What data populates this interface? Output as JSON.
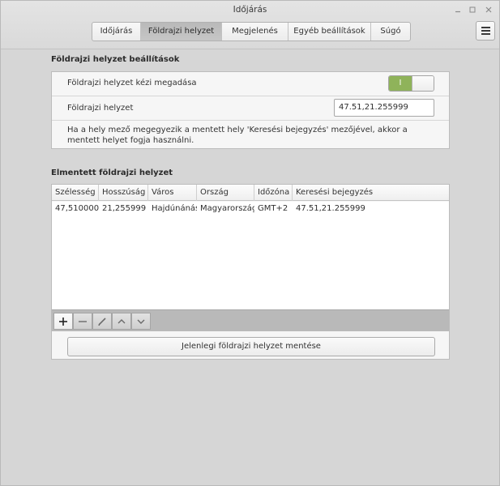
{
  "window": {
    "title": "Időjárás"
  },
  "tabs": [
    {
      "label": "Időjárás"
    },
    {
      "label": "Földrajzi helyzet"
    },
    {
      "label": "Megjelenés"
    },
    {
      "label": "Egyéb beállítások"
    },
    {
      "label": "Súgó"
    }
  ],
  "active_tab": "Földrajzi helyzet",
  "location_settings": {
    "heading": "Földrajzi helyzet beállítások",
    "manual_label": "Földrajzi helyzet kézi megadása",
    "manual_toggle": {
      "state": "on",
      "on_text": "I"
    },
    "location_label": "Földrajzi helyzet",
    "location_value": "47.51,21.255999",
    "note": "Ha a hely mező megegyezik a mentett hely 'Keresési bejegyzés' mezőjével, akkor a mentett helyet fogja használni."
  },
  "saved_locations": {
    "heading": "Elmentett földrajzi helyzet",
    "columns": [
      "Szélesség",
      "Hosszúság",
      "Város",
      "Ország",
      "Időzóna",
      "Keresési bejegyzés"
    ],
    "rows": [
      [
        "47,510000",
        "21,255999",
        "Hajdúnánás",
        "Magyarország",
        "GMT+2",
        "47.51,21.255999"
      ]
    ],
    "save_button": "Jelenlegi földrajzi helyzet mentése"
  },
  "icons": {
    "add": "plus-icon",
    "remove": "minus-icon",
    "edit": "pencil-icon",
    "move_up": "chevron-up-icon",
    "move_down": "chevron-down-icon",
    "menu": "hamburger-menu-icon"
  },
  "colors": {
    "toggle_on": "#8fb35a",
    "active_tab": "#bdbdbd",
    "background": "#d6d6d6"
  }
}
